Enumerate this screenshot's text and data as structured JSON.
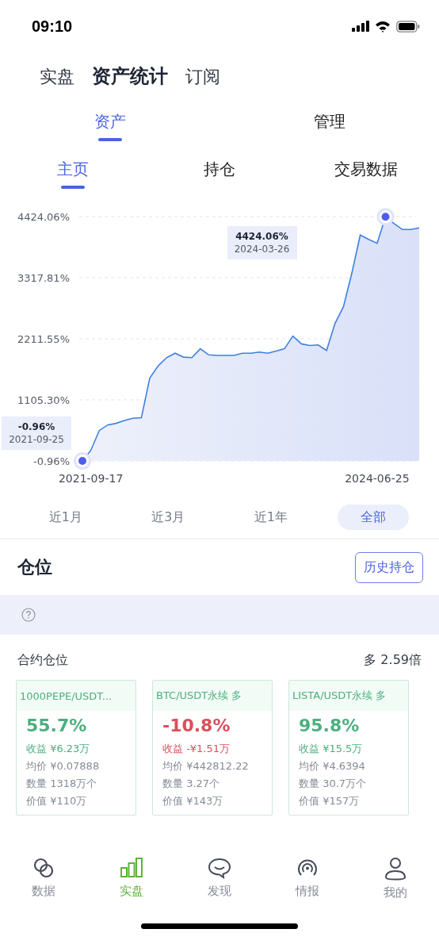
{
  "status_bar": {
    "time": "09:10"
  },
  "top_tabs": [
    {
      "label": "实盘",
      "selected": false
    },
    {
      "label": "资产统计",
      "selected": true
    },
    {
      "label": "订阅",
      "selected": false
    }
  ],
  "section_tabs": [
    {
      "label": "资产",
      "selected": true
    },
    {
      "label": "管理",
      "selected": false
    }
  ],
  "sub_tabs": [
    {
      "label": "主页",
      "selected": true
    },
    {
      "label": "持仓",
      "selected": false
    },
    {
      "label": "交易数据",
      "selected": false
    }
  ],
  "chart": {
    "chart_data": {
      "type": "area",
      "ylim": [
        -0.96,
        4424.06
      ],
      "yticks": [
        {
          "value": 4424.06,
          "label": "4424.06%"
        },
        {
          "value": 3317.81,
          "label": "3317.81%"
        },
        {
          "value": 2211.55,
          "label": "2211.55%"
        },
        {
          "value": 1105.3,
          "label": "1105.30%"
        },
        {
          "value": -0.96,
          "label": "-0.96%"
        }
      ],
      "grid": true,
      "categories": [
        null,
        "2021-09-17",
        null,
        null,
        null,
        null,
        null,
        null,
        null,
        null,
        null,
        null,
        null,
        null,
        null,
        null,
        null,
        null,
        null,
        null,
        null,
        null,
        null,
        null,
        null,
        null,
        null,
        null,
        null,
        null,
        null,
        null,
        null,
        null,
        null,
        "2024-06-25",
        null,
        null,
        null,
        null,
        null
      ],
      "series": [
        {
          "color": "#3d7fe0",
          "values": [
            0,
            190,
            550,
            650,
            680,
            730,
            770,
            780,
            1500,
            1720,
            1870,
            1950,
            1880,
            1870,
            2030,
            1920,
            1910,
            1910,
            1910,
            1950,
            1950,
            1970,
            1950,
            1990,
            2030,
            2260,
            2120,
            2090,
            2100,
            2000,
            2490,
            2790,
            3400,
            4090,
            4010,
            3940,
            4420,
            4300,
            4190,
            4190,
            4220
          ]
        }
      ],
      "annotations": [
        "-0.96%",
        "2021-09-25",
        "4424.06%",
        "2024-03-26"
      ]
    }
  },
  "ranges": [
    {
      "label": "近1月",
      "selected": false
    },
    {
      "label": "近3月",
      "selected": false
    },
    {
      "label": "近1年",
      "selected": false
    },
    {
      "label": "全部",
      "selected": true
    }
  ],
  "positions": {
    "title": "仓位",
    "history_button": "历史持仓",
    "contract_title": "合约仓位",
    "leverage": "多 2.59倍",
    "cards": [
      {
        "name": "1000PEPE/USDT...",
        "kind": "gain",
        "percent": "55.7%",
        "profit": "收益 ¥6.23万",
        "lines": [
          "均价 ¥0.07888",
          "数量 1318万个",
          "价值 ¥110万"
        ]
      },
      {
        "name": "BTC/USDT永续 多",
        "kind": "loss",
        "percent": "-10.8%",
        "profit": "收益 -¥1.51万",
        "lines": [
          "均价 ¥442812.22",
          "数量 3.27个",
          "价值 ¥143万"
        ]
      },
      {
        "name": "LISTA/USDT永续 多",
        "kind": "gain",
        "percent": "95.8%",
        "profit": "收益 ¥15.5万",
        "lines": [
          "均价 ¥4.6394",
          "数量 30.7万个",
          "价值 ¥157万"
        ]
      }
    ]
  },
  "bottom_nav": [
    {
      "label": "数据",
      "kind": "circles",
      "selected": false
    },
    {
      "label": "实盘",
      "kind": "bars",
      "selected": true
    },
    {
      "label": "发现",
      "kind": "chat",
      "selected": false
    },
    {
      "label": "情报",
      "kind": "signal",
      "selected": false
    },
    {
      "label": "我的",
      "kind": "person",
      "selected": false
    }
  ]
}
